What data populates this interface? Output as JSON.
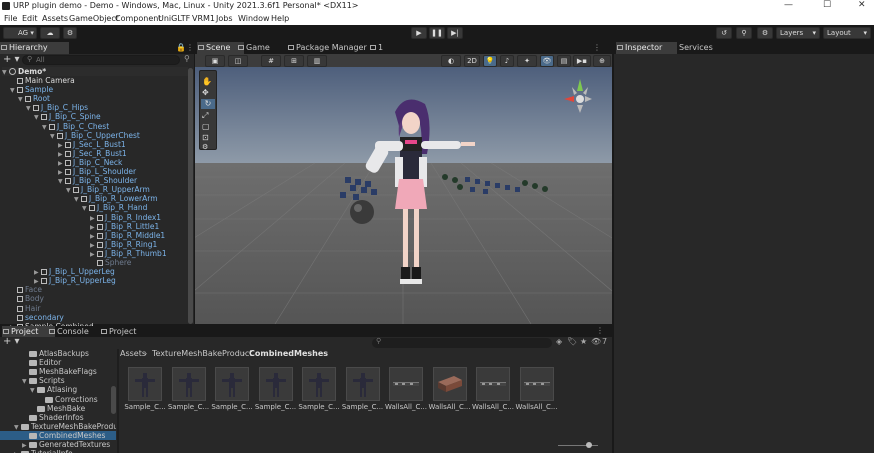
{
  "window": {
    "title": "URP plugin demo - Demo - Windows, Mac, Linux - Unity 2021.3.6f1 Personal* <DX11>",
    "min": "—",
    "max": "☐",
    "close": "✕"
  },
  "menu": [
    "File",
    "Edit",
    "Assets",
    "GameObject",
    "Component",
    "UniGLTF",
    "VRM1",
    "Jobs",
    "Window",
    "Help"
  ],
  "toolbar": {
    "account": "AG",
    "layers": "Layers",
    "layout": "Layout"
  },
  "hierarchy": {
    "tab": "Hierarchy",
    "search_placeholder": "All",
    "scene_name": "Demo*",
    "rows": [
      {
        "label": "Main Camera",
        "depth": 1,
        "arrow": "",
        "color": "white"
      },
      {
        "label": "Sample",
        "depth": 1,
        "arrow": "▼",
        "color": "blue"
      },
      {
        "label": "Root",
        "depth": 2,
        "arrow": "▼",
        "color": "blue"
      },
      {
        "label": "J_Bip_C_Hips",
        "depth": 3,
        "arrow": "▼",
        "color": "blue"
      },
      {
        "label": "J_Bip_C_Spine",
        "depth": 4,
        "arrow": "▼",
        "color": "blue"
      },
      {
        "label": "J_Bip_C_Chest",
        "depth": 5,
        "arrow": "▼",
        "color": "blue"
      },
      {
        "label": "J_Bip_C_UpperChest",
        "depth": 6,
        "arrow": "▼",
        "color": "blue"
      },
      {
        "label": "J_Sec_L_Bust1",
        "depth": 7,
        "arrow": "▶",
        "color": "blue"
      },
      {
        "label": "J_Sec_R_Bust1",
        "depth": 7,
        "arrow": "▶",
        "color": "blue"
      },
      {
        "label": "J_Bip_C_Neck",
        "depth": 7,
        "arrow": "▶",
        "color": "blue"
      },
      {
        "label": "J_Bip_L_Shoulder",
        "depth": 7,
        "arrow": "▶",
        "color": "blue"
      },
      {
        "label": "J_Bip_R_Shoulder",
        "depth": 7,
        "arrow": "▼",
        "color": "blue"
      },
      {
        "label": "J_Bip_R_UpperArm",
        "depth": 8,
        "arrow": "▼",
        "color": "blue"
      },
      {
        "label": "J_Bip_R_LowerArm",
        "depth": 9,
        "arrow": "▼",
        "color": "blue"
      },
      {
        "label": "J_Bip_R_Hand",
        "depth": 10,
        "arrow": "▼",
        "color": "blue"
      },
      {
        "label": "J_Bip_R_Index1",
        "depth": 11,
        "arrow": "▶",
        "color": "blue"
      },
      {
        "label": "J_Bip_R_Little1",
        "depth": 11,
        "arrow": "▶",
        "color": "blue"
      },
      {
        "label": "J_Bip_R_Middle1",
        "depth": 11,
        "arrow": "▶",
        "color": "blue"
      },
      {
        "label": "J_Bip_R_Ring1",
        "depth": 11,
        "arrow": "▶",
        "color": "blue"
      },
      {
        "label": "J_Bip_R_Thumb1",
        "depth": 11,
        "arrow": "▶",
        "color": "blue"
      },
      {
        "label": "Sphere",
        "depth": 11,
        "arrow": "",
        "color": "gray"
      },
      {
        "label": "J_Bip_L_UpperLeg",
        "depth": 4,
        "arrow": "▶",
        "color": "blue"
      },
      {
        "label": "J_Bip_R_UpperLeg",
        "depth": 4,
        "arrow": "▶",
        "color": "blue"
      },
      {
        "label": "Face",
        "depth": 1,
        "arrow": "",
        "color": "gray"
      },
      {
        "label": "Body",
        "depth": 1,
        "arrow": "",
        "color": "gray"
      },
      {
        "label": "Hair",
        "depth": 1,
        "arrow": "",
        "color": "gray"
      },
      {
        "label": "secondary",
        "depth": 1,
        "arrow": "",
        "color": "blue"
      },
      {
        "label": "Sample Combined",
        "depth": 1,
        "arrow": "▶",
        "color": "white"
      }
    ]
  },
  "scene_tabs": [
    "Scene",
    "Game",
    "Package Manager",
    "1"
  ],
  "scene_toolbar": {
    "mode2d": "2D"
  },
  "inspector_tabs": [
    "Inspector",
    "Services"
  ],
  "bottom_tabs": [
    "Project",
    "Console",
    "Project"
  ],
  "project": {
    "breadcrumb": [
      "Assets",
      "TextureMeshBakeProduct",
      "CombinedMeshes"
    ],
    "hidden_count": "7",
    "tree": [
      {
        "label": "AtlasBackups",
        "depth": 2,
        "arrow": ""
      },
      {
        "label": "Editor",
        "depth": 2,
        "arrow": ""
      },
      {
        "label": "MeshBakeFlags",
        "depth": 2,
        "arrow": ""
      },
      {
        "label": "Scripts",
        "depth": 2,
        "arrow": "▼"
      },
      {
        "label": "Atlasing",
        "depth": 3,
        "arrow": "▼"
      },
      {
        "label": "Corrections",
        "depth": 4,
        "arrow": ""
      },
      {
        "label": "MeshBake",
        "depth": 3,
        "arrow": ""
      },
      {
        "label": "ShaderInfos",
        "depth": 2,
        "arrow": ""
      },
      {
        "label": "TextureMeshBakeProduc",
        "depth": 1,
        "arrow": "▼"
      },
      {
        "label": "CombinedMeshes",
        "depth": 2,
        "arrow": "",
        "selected": true
      },
      {
        "label": "GeneratedTextures",
        "depth": 2,
        "arrow": "▶"
      },
      {
        "label": "TutorialInfo",
        "depth": 1,
        "arrow": "▶"
      }
    ],
    "assets": [
      {
        "label": "Sample_C...",
        "kind": "figure"
      },
      {
        "label": "Sample_C...",
        "kind": "figure"
      },
      {
        "label": "Sample_C...",
        "kind": "figure"
      },
      {
        "label": "Sample_C...",
        "kind": "figure"
      },
      {
        "label": "Sample_C...",
        "kind": "figure"
      },
      {
        "label": "Sample_C...",
        "kind": "figure"
      },
      {
        "label": "WallsAll_C...",
        "kind": "wall"
      },
      {
        "label": "WallsAll_C...",
        "kind": "wall-red"
      },
      {
        "label": "WallsAll_C...",
        "kind": "wall"
      },
      {
        "label": "WallsAll_C...",
        "kind": "wall"
      }
    ]
  },
  "colors": {
    "accent": "#7cb4ea",
    "selected": "#2c5d87",
    "panel": "#282828",
    "sky": "#5c6e8a"
  }
}
